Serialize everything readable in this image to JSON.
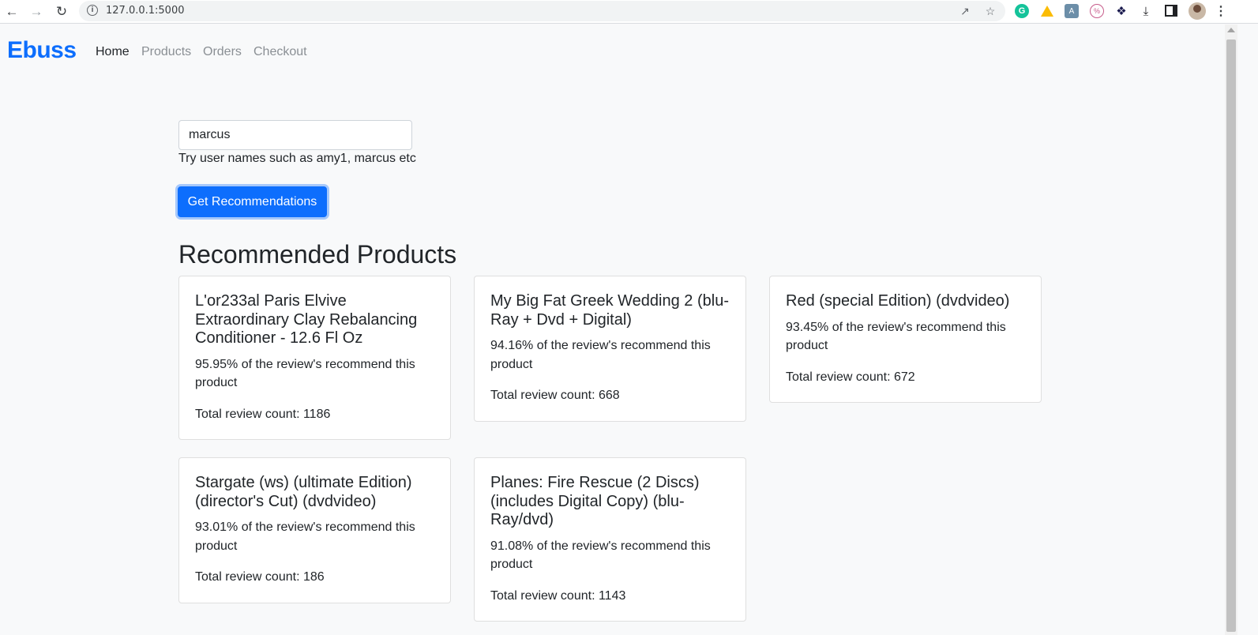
{
  "browser": {
    "url": "127.0.0.1:5000"
  },
  "navbar": {
    "brand": "Ebuss",
    "links": [
      {
        "label": "Home",
        "active": true
      },
      {
        "label": "Products",
        "active": false
      },
      {
        "label": "Orders",
        "active": false
      },
      {
        "label": "Checkout",
        "active": false
      }
    ]
  },
  "form": {
    "username_value": "marcus",
    "hint": "Try user names such as amy1, marcus etc",
    "submit_label": "Get Recommendations"
  },
  "recommendations": {
    "title": "Recommended Products",
    "products": [
      {
        "name": "L'or233al Paris Elvive Extraordinary Clay Rebalancing Conditioner - 12.6 Fl Oz",
        "recommend_text": "95.95% of the review's recommend this product",
        "count_text": "Total review count: 1186"
      },
      {
        "name": "My Big Fat Greek Wedding 2 (blu-Ray + Dvd + Digital)",
        "recommend_text": "94.16% of the review's recommend this product",
        "count_text": "Total review count: 668"
      },
      {
        "name": "Red (special Edition) (dvdvideo)",
        "recommend_text": "93.45% of the review's recommend this product",
        "count_text": "Total review count: 672"
      },
      {
        "name": "Stargate (ws) (ultimate Edition) (director's Cut) (dvdvideo)",
        "recommend_text": "93.01% of the review's recommend this product",
        "count_text": "Total review count: 186"
      },
      {
        "name": "Planes: Fire Rescue (2 Discs) (includes Digital Copy) (blu-Ray/dvd)",
        "recommend_text": "91.08% of the review's recommend this product",
        "count_text": "Total review count: 1143"
      }
    ]
  },
  "colors": {
    "brand": "#0d6efd",
    "page_bg": "#f8f9fa"
  }
}
